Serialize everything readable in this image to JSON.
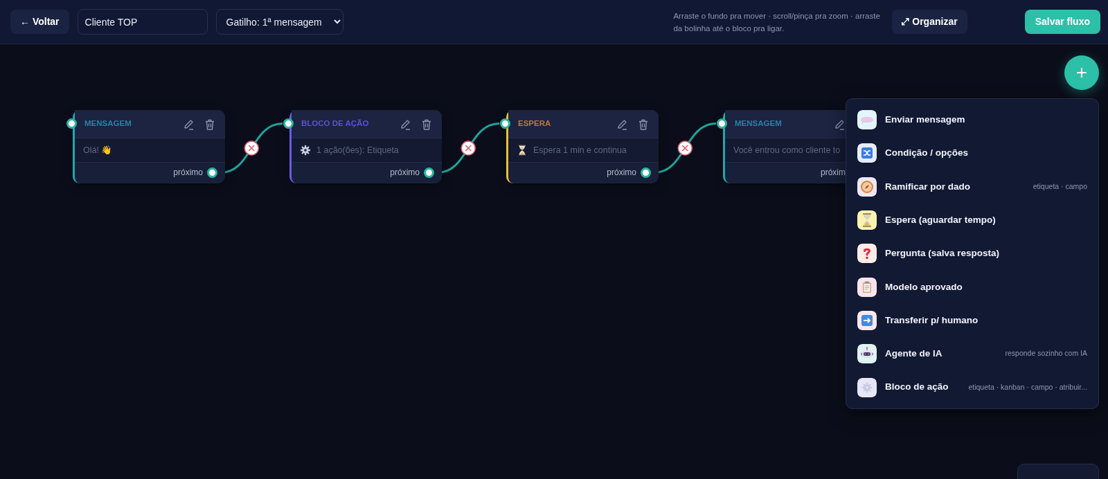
{
  "toolbar": {
    "back_button": "← Voltar",
    "flow_name": "Cliente TOP",
    "trigger": "Gatilho: 1ª mensagem",
    "hint": "Arraste o fundo pra mover · scroll/pinça pra zoom · arraste da bolinha até o bloco pra ligar.",
    "organize_button": "⤢ Organizar",
    "save_button": "Salvar fluxo"
  },
  "add_button": "+",
  "nodes": [
    {
      "kind": "message",
      "title": "MENSAGEM",
      "text": "Olá!  👋",
      "port_label": "próximo"
    },
    {
      "kind": "action",
      "title": "BLOCO DE AÇÃO",
      "text": "1 ação(ões): Etiqueta",
      "port_label": "próximo"
    },
    {
      "kind": "wait",
      "title": "ESPERA",
      "text": "Espera 1 min e continua",
      "port_label": "próximo"
    },
    {
      "kind": "message",
      "title": "MENSAGEM",
      "text": "Você entrou como cliente to",
      "port_label": "próxim"
    }
  ],
  "menu": [
    {
      "label": "Enviar mensagem"
    },
    {
      "label": "Condição / opções"
    },
    {
      "label": "Ramificar por dado",
      "hint": "etiqueta · campo"
    },
    {
      "label": "Espera (aguardar tempo)"
    },
    {
      "label": "Pergunta (salva resposta)"
    },
    {
      "label": "Modelo aprovado"
    },
    {
      "label": "Transferir p/ humano"
    },
    {
      "label": "Agente de IA",
      "hint": "responde sozinho com IA"
    },
    {
      "label": "Bloco de ação",
      "hint": "etiqueta · kanban · campo · atribuir..."
    }
  ]
}
